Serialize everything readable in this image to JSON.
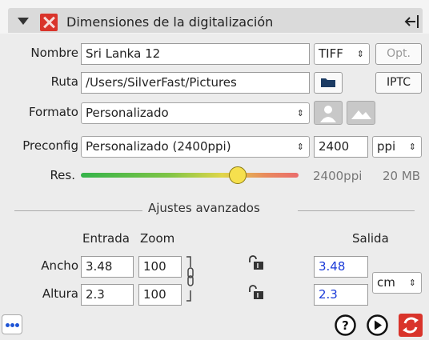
{
  "panel": {
    "title": "Dimensiones de la digitalización"
  },
  "nombre": {
    "label": "Nombre",
    "value": "Sri Lanka 12",
    "format": "TIFF",
    "opt_label": "Opt."
  },
  "ruta": {
    "label": "Ruta",
    "value": "/Users/SilverFast/Pictures",
    "iptc_label": "IPTC"
  },
  "formato": {
    "label": "Formato",
    "value": "Personalizado"
  },
  "preconfig": {
    "label": "Preconfig",
    "value": "Personalizado (2400ppi)",
    "resolution": "2400",
    "unit": "ppi"
  },
  "res": {
    "label": "Res.",
    "ppi_text": "2400ppi",
    "size_text": "20 MB",
    "slider_level": 0.72
  },
  "advanced": {
    "label": "Ajustes avanzados"
  },
  "columns": {
    "entrada": "Entrada",
    "zoom": "Zoom",
    "salida": "Salida"
  },
  "ancho": {
    "label": "Ancho",
    "entrada": "3.48",
    "zoom": "100",
    "salida": "3.48"
  },
  "altura": {
    "label": "Altura",
    "entrada": "2.3",
    "zoom": "100",
    "salida": "2.3"
  },
  "output_unit": "cm",
  "colors": {
    "accent_blue": "#1a3ad8",
    "icon_red": "#d9342b",
    "dots_blue": "#1f55d6"
  }
}
